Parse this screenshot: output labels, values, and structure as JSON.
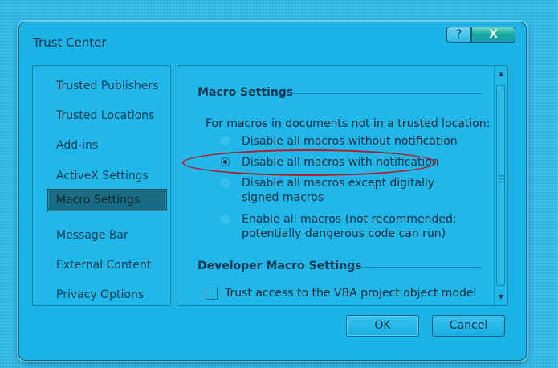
{
  "window": {
    "title": "Trust Center",
    "help_label": "?",
    "close_label": "X"
  },
  "sidebar": {
    "items": [
      {
        "label": "Trusted Publishers"
      },
      {
        "label": "Trusted Locations"
      },
      {
        "label": "Add-ins"
      },
      {
        "label": "ActiveX Settings"
      },
      {
        "label": "Macro Settings",
        "selected": true
      },
      {
        "label": "Message Bar"
      },
      {
        "label": "External Content"
      },
      {
        "label": "Privacy Options"
      }
    ]
  },
  "macro_settings": {
    "heading": "Macro Settings",
    "intro": "For macros in documents not in a trusted location:",
    "options": [
      {
        "label": "Disable all macros without notification",
        "checked": false
      },
      {
        "label": "Disable all macros with notification",
        "checked": true
      },
      {
        "label": "Disable all macros except digitally signed macros",
        "checked": false
      },
      {
        "label": "Enable all macros (not recommended; potentially dangerous code can run)",
        "checked": false
      }
    ]
  },
  "developer_settings": {
    "heading": "Developer Macro Settings",
    "vba_access_label": "Trust access to the VBA project object model",
    "vba_access_checked": false
  },
  "footer": {
    "ok_label": "OK",
    "cancel_label": "Cancel"
  },
  "colors": {
    "highlight_ellipse": "#b01c2c",
    "background": "#2fb6e3"
  }
}
